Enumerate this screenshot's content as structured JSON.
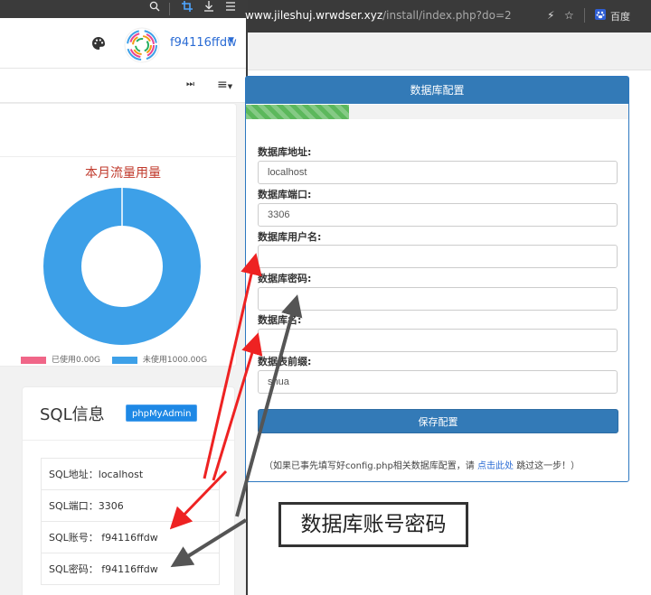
{
  "left_window": {
    "titlebar_icons": [
      "search-icon",
      "crop-icon",
      "download-icon",
      "menu-icon"
    ],
    "username": "f94116ffdw",
    "chart_card": {
      "title": "本月流量用量"
    },
    "sql_card": {
      "title": "SQL信息",
      "phpmyadmin_button": "phpMyAdmin",
      "rows": [
        "SQL地址：localhost",
        "SQL端口：3306",
        "SQL账号： f94116ffdw",
        "SQL密码： f94116ffdw"
      ]
    }
  },
  "chart_data": {
    "type": "pie",
    "title": "本月流量用量",
    "labels": [
      "已使用0.00G",
      "未使用1000.00G"
    ],
    "values": [
      0.0,
      1000.0
    ],
    "colors": [
      "#f06688",
      "#3da0e8"
    ],
    "legend_position": "bottom"
  },
  "browser": {
    "url_prefix": "www.jileshuj.wrwdser.xyz",
    "url_path": "/install/index.php?do=2",
    "baidu_label": "百度",
    "panel_title": "数据库配置",
    "progress_fraction": 0.27,
    "fields": [
      {
        "label": "数据库地址:",
        "value": "localhost"
      },
      {
        "label": "数据库端口:",
        "value": "3306"
      },
      {
        "label": "数据库用户名:",
        "value": ""
      },
      {
        "label": "数据库密码:",
        "value": ""
      },
      {
        "label": "数据库名:",
        "value": ""
      },
      {
        "label": "数据表前缀:",
        "value": "shua"
      }
    ],
    "save_button": "保存配置",
    "footnote_before": "（如果已事先填写好config.php相关数据库配置，请",
    "footnote_link": "点击此处",
    "footnote_after": "跳过这一步！）"
  },
  "annotation": {
    "callout_text": "数据库账号密码",
    "arrow_colors": [
      "#ee2222",
      "#555555"
    ]
  }
}
